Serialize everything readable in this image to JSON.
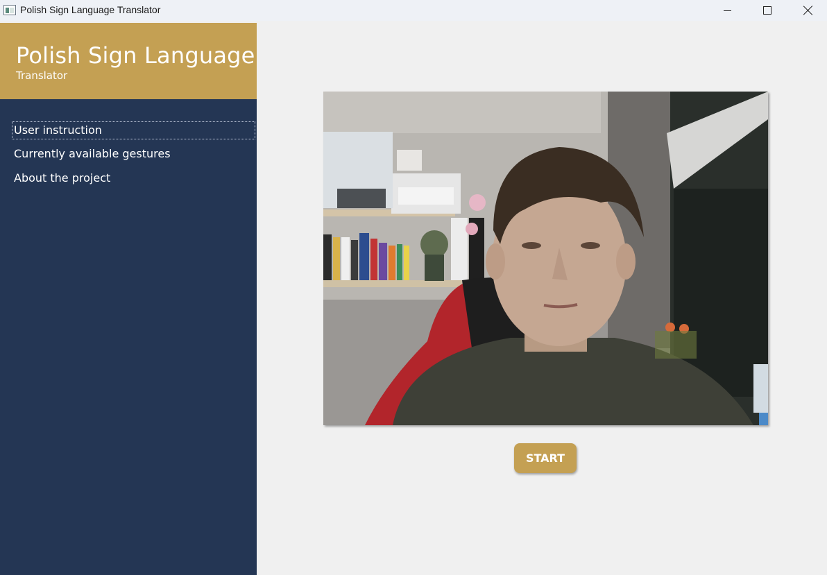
{
  "window": {
    "title": "Polish Sign Language Translator",
    "icon": "app-window-icon",
    "controls": [
      "minimize-icon",
      "maximize-icon",
      "close-icon"
    ]
  },
  "sidebar": {
    "brand_title": "Polish Sign Language",
    "brand_subtitle": "Translator",
    "items": [
      {
        "label": "User instruction",
        "focused": true
      },
      {
        "label": "Currently available gestures",
        "focused": false
      },
      {
        "label": "About the project",
        "focused": false
      }
    ]
  },
  "main": {
    "start_label": "START"
  },
  "colors": {
    "accent": "#c4a053",
    "sidebar": "#243654",
    "background": "#f0f0f0"
  }
}
